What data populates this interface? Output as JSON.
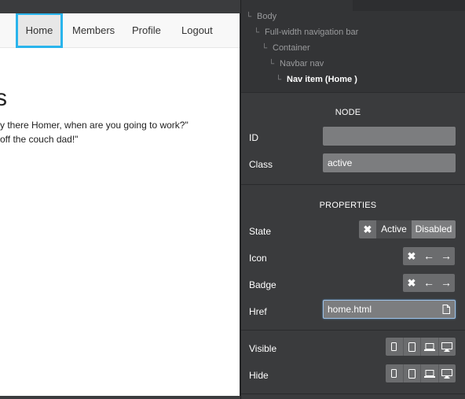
{
  "navbar": {
    "items": [
      {
        "label": "Home",
        "active": true
      },
      {
        "label": "Members"
      },
      {
        "label": "Profile"
      },
      {
        "label": "Logout"
      }
    ]
  },
  "content": {
    "heading_fragment": "s",
    "quote_line_1": "y there Homer, when are you going to work?\"",
    "quote_line_2": "off the couch dad!\""
  },
  "tree": {
    "items": [
      {
        "label": "Body"
      },
      {
        "label": "Full-width navigation bar"
      },
      {
        "label": "Container"
      },
      {
        "label": "Navbar nav"
      },
      {
        "label": "Nav item (Home )",
        "current": true
      }
    ]
  },
  "node": {
    "title": "NODE",
    "id_label": "ID",
    "id_value": "",
    "class_label": "Class",
    "class_value": "active"
  },
  "properties": {
    "title": "PROPERTIES",
    "state_label": "State",
    "state_options": [
      "Active",
      "Disabled"
    ],
    "icon_label": "Icon",
    "badge_label": "Badge",
    "href_label": "Href",
    "href_value": "home.html",
    "visible_label": "Visible",
    "hide_label": "Hide"
  },
  "colors": {
    "selection_outline": "#29b4ec",
    "panel_bg": "#3a3b3d",
    "field_bg": "#7c7d7f"
  },
  "icons": {
    "clear": "x-icon",
    "prev": "arrow-left-icon",
    "next": "arrow-right-icon",
    "file": "file-icon",
    "devices": [
      "phone-icon",
      "tablet-icon",
      "laptop-icon",
      "desktop-icon"
    ]
  }
}
